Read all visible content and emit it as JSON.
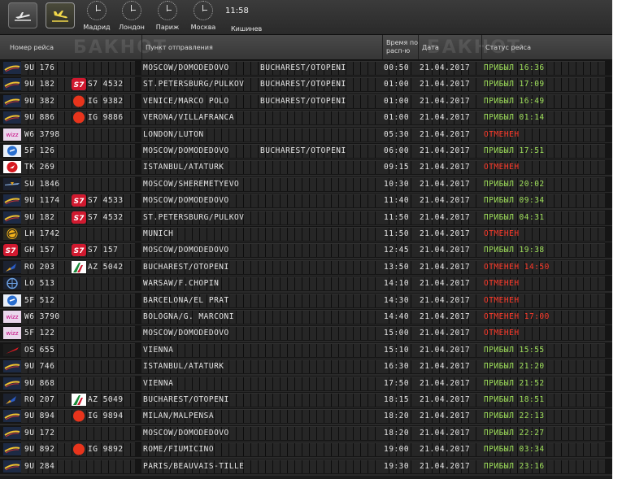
{
  "topbar": {
    "departures_label": "departures",
    "arrivals_label": "arrivals",
    "clocks": [
      {
        "city": "Мадрид"
      },
      {
        "city": "Лондон"
      },
      {
        "city": "Париж"
      },
      {
        "city": "Москва"
      }
    ],
    "time": "11:58",
    "local_city": "Кишинев"
  },
  "watermark": "БАКНОТ",
  "columns": {
    "flight": "Номер рейса",
    "from": "Пункт отправления",
    "sched_line1": "Время по",
    "sched_line2": "расп-ю",
    "date": "Дата",
    "status": "Статус рейса"
  },
  "colors": {
    "arrived": "#9fe05a",
    "cancelled": "#ff3a2a",
    "text": "#e6e6e6"
  },
  "flights": [
    {
      "icon": "air-moldova-icon",
      "flight": "9U 176",
      "code2_icon": "",
      "code2": "",
      "from": "MOSCOW/DOMODEDOVO",
      "via": "BUCHAREST/OTOPENI",
      "time": "00:50",
      "date": "21.04.2017",
      "status": "ПРИБЫЛ 16:36",
      "state": "arrived"
    },
    {
      "icon": "air-moldova-icon",
      "flight": "9U 182",
      "code2_icon": "s7-icon",
      "code2": "S7 4532",
      "from": "ST.PETERSBURG/PULKOV",
      "via": "BUCHAREST/OTOPENI",
      "time": "01:00",
      "date": "21.04.2017",
      "status": "ПРИБЫЛ 17:09",
      "state": "arrived"
    },
    {
      "icon": "air-moldova-icon",
      "flight": "9U 382",
      "code2_icon": "alitalia-red-icon",
      "code2": "IG 9382",
      "from": "VENICE/MARCO POLO",
      "via": "BUCHAREST/OTOPENI",
      "time": "01:00",
      "date": "21.04.2017",
      "status": "ПРИБЫЛ 16:49",
      "state": "arrived"
    },
    {
      "icon": "air-moldova-icon",
      "flight": "9U 886",
      "code2_icon": "alitalia-red-icon",
      "code2": "IG 9886",
      "from": "VERONA/VILLAFRANCA",
      "via": "",
      "time": "01:00",
      "date": "21.04.2017",
      "status": "ПРИБЫЛ 01:14",
      "state": "arrived"
    },
    {
      "icon": "wizz-air-icon",
      "flight": "W6 3798",
      "code2_icon": "",
      "code2": "",
      "from": "LONDON/LUTON",
      "via": "",
      "time": "05:30",
      "date": "21.04.2017",
      "status": "ОТМЕНЕН",
      "state": "cancelled"
    },
    {
      "icon": "fly-one-icon",
      "flight": "5F 126",
      "code2_icon": "",
      "code2": "",
      "from": "MOSCOW/DOMODEDOVO",
      "via": "BUCHAREST/OTOPENI",
      "time": "06:00",
      "date": "21.04.2017",
      "status": "ПРИБЫЛ 17:51",
      "state": "arrived"
    },
    {
      "icon": "turkish-airlines-icon",
      "flight": "TK 269",
      "code2_icon": "",
      "code2": "",
      "from": "ISTANBUL/ATATURK",
      "via": "",
      "time": "09:15",
      "date": "21.04.2017",
      "status": "ОТМЕНЕН",
      "state": "cancelled"
    },
    {
      "icon": "aeroflot-icon",
      "flight": "SU 1846",
      "code2_icon": "",
      "code2": "",
      "from": "MOSCOW/SHEREMETYEVO",
      "via": "",
      "time": "10:30",
      "date": "21.04.2017",
      "status": "ПРИБЫЛ 20:02",
      "state": "arrived"
    },
    {
      "icon": "air-moldova-icon",
      "flight": "9U 1174",
      "code2_icon": "s7-icon",
      "code2": "S7 4533",
      "from": "MOSCOW/DOMODEDOVO",
      "via": "",
      "time": "11:40",
      "date": "21.04.2017",
      "status": "ПРИБЫЛ 09:34",
      "state": "arrived"
    },
    {
      "icon": "air-moldova-icon",
      "flight": "9U 182",
      "code2_icon": "s7-icon",
      "code2": "S7 4532",
      "from": "ST.PETERSBURG/PULKOV",
      "via": "",
      "time": "11:50",
      "date": "21.04.2017",
      "status": "ПРИБЫЛ 04:31",
      "state": "arrived"
    },
    {
      "icon": "lufthansa-icon",
      "flight": "LH 1742",
      "code2_icon": "",
      "code2": "",
      "from": "MUNICH",
      "via": "",
      "time": "11:50",
      "date": "21.04.2017",
      "status": "ОТМЕНЕН",
      "state": "cancelled"
    },
    {
      "icon": "s7-icon",
      "flight": "GH 157",
      "code2_icon": "s7-icon",
      "code2": "S7 157",
      "from": "MOSCOW/DOMODEDOVO",
      "via": "",
      "time": "12:45",
      "date": "21.04.2017",
      "status": "ПРИБЫЛ 19:38",
      "state": "arrived"
    },
    {
      "icon": "tarom-icon",
      "flight": "RO 203",
      "code2_icon": "alitalia-icon",
      "code2": "AZ 5042",
      "from": "BUCHAREST/OTOPENI",
      "via": "",
      "time": "13:50",
      "date": "21.04.2017",
      "status": "ОТМЕНЕН 14:50",
      "state": "cancelled"
    },
    {
      "icon": "lot-icon",
      "flight": "LO 513",
      "code2_icon": "",
      "code2": "",
      "from": "WARSAW/F.CHOPIN",
      "via": "",
      "time": "14:10",
      "date": "21.04.2017",
      "status": "ОТМЕНЕН",
      "state": "cancelled"
    },
    {
      "icon": "fly-one-icon",
      "flight": "5F 512",
      "code2_icon": "",
      "code2": "",
      "from": "BARCELONA/EL PRAT",
      "via": "",
      "time": "14:30",
      "date": "21.04.2017",
      "status": "ОТМЕНЕН",
      "state": "cancelled"
    },
    {
      "icon": "wizz-air-icon",
      "flight": "W6 3790",
      "code2_icon": "",
      "code2": "",
      "from": "BOLOGNA/G. MARCONI",
      "via": "",
      "time": "14:40",
      "date": "21.04.2017",
      "status": "ОТМЕНЕН 17:00",
      "state": "cancelled"
    },
    {
      "icon": "wizz-air-icon",
      "flight": "5F 122",
      "code2_icon": "",
      "code2": "",
      "from": "MOSCOW/DOMODEDOVO",
      "via": "",
      "time": "15:00",
      "date": "21.04.2017",
      "status": "ОТМЕНЕН",
      "state": "cancelled"
    },
    {
      "icon": "austrian-icon",
      "flight": "OS 655",
      "code2_icon": "",
      "code2": "",
      "from": "VIENNA",
      "via": "",
      "time": "15:10",
      "date": "21.04.2017",
      "status": "ПРИБЫЛ 15:55",
      "state": "arrived"
    },
    {
      "icon": "air-moldova-icon",
      "flight": "9U 746",
      "code2_icon": "",
      "code2": "",
      "from": "ISTANBUL/ATATURK",
      "via": "",
      "time": "16:30",
      "date": "21.04.2017",
      "status": "ПРИБЫЛ 21:20",
      "state": "arrived"
    },
    {
      "icon": "air-moldova-icon",
      "flight": "9U 868",
      "code2_icon": "",
      "code2": "",
      "from": "VIENNA",
      "via": "",
      "time": "17:50",
      "date": "21.04.2017",
      "status": "ПРИБЫЛ 21:52",
      "state": "arrived"
    },
    {
      "icon": "tarom-icon",
      "flight": "RO 207",
      "code2_icon": "alitalia-icon",
      "code2": "AZ 5049",
      "from": "BUCHAREST/OTOPENI",
      "via": "",
      "time": "18:15",
      "date": "21.04.2017",
      "status": "ПРИБЫЛ 18:51",
      "state": "arrived"
    },
    {
      "icon": "air-moldova-icon",
      "flight": "9U 894",
      "code2_icon": "alitalia-red-icon",
      "code2": "IG 9894",
      "from": "MILAN/MALPENSA",
      "via": "",
      "time": "18:20",
      "date": "21.04.2017",
      "status": "ПРИБЫЛ 22:13",
      "state": "arrived"
    },
    {
      "icon": "air-moldova-icon",
      "flight": "9U 172",
      "code2_icon": "",
      "code2": "",
      "from": "MOSCOW/DOMODEDOVO",
      "via": "",
      "time": "18:20",
      "date": "21.04.2017",
      "status": "ПРИБЫЛ 22:27",
      "state": "arrived"
    },
    {
      "icon": "air-moldova-icon",
      "flight": "9U 892",
      "code2_icon": "alitalia-red-icon",
      "code2": "IG 9892",
      "from": "ROME/FIUMICINO",
      "via": "",
      "time": "19:00",
      "date": "21.04.2017",
      "status": "ПРИБЫЛ 03:34",
      "state": "arrived"
    },
    {
      "icon": "air-moldova-icon",
      "flight": "9U 284",
      "code2_icon": "",
      "code2": "",
      "from": "PARIS/BEAUVAIS-TILLE",
      "via": "",
      "time": "19:30",
      "date": "21.04.2017",
      "status": "ПРИБЫЛ 23:16",
      "state": "arrived"
    }
  ]
}
